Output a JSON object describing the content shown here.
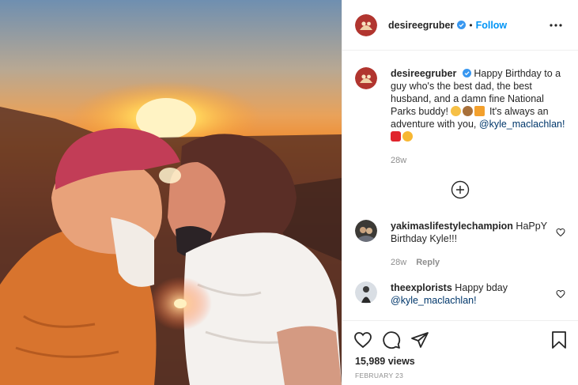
{
  "post": {
    "photo_icon": "couple-kissing-at-sunset-photo",
    "author": "desireegruber",
    "follow_label": "Follow",
    "separator": "•",
    "caption_text": "Happy Birthday to a guy who's the best dad, the best husband, and a damn fine National Parks buddy!",
    "caption_text_2": "It's always an adventure with you,",
    "caption_mention": "@kyle_maclachlan!",
    "caption_emojis": [
      "clapping-emoji",
      "burger-emoji",
      "party-hat-emoji"
    ],
    "caption_end_emojis": [
      "red-heart-emoji",
      "smiling-face-with-hearts-emoji"
    ],
    "caption_age": "28w",
    "likes": "15,989 views",
    "date": "FEBRUARY 23"
  },
  "comments": [
    {
      "username": "yakimaslifestylechampion",
      "text": "HaPpY Birthday Kyle!!!",
      "age": "28w",
      "reply_label": "Reply"
    },
    {
      "username": "theexplorists",
      "text": "Happy bday",
      "mention": "@kyle_maclachlan!"
    }
  ],
  "colors": {
    "accent": "#0095f6",
    "verified": "#3897f0",
    "mention": "#00376b",
    "muted": "#8e8e8e"
  }
}
